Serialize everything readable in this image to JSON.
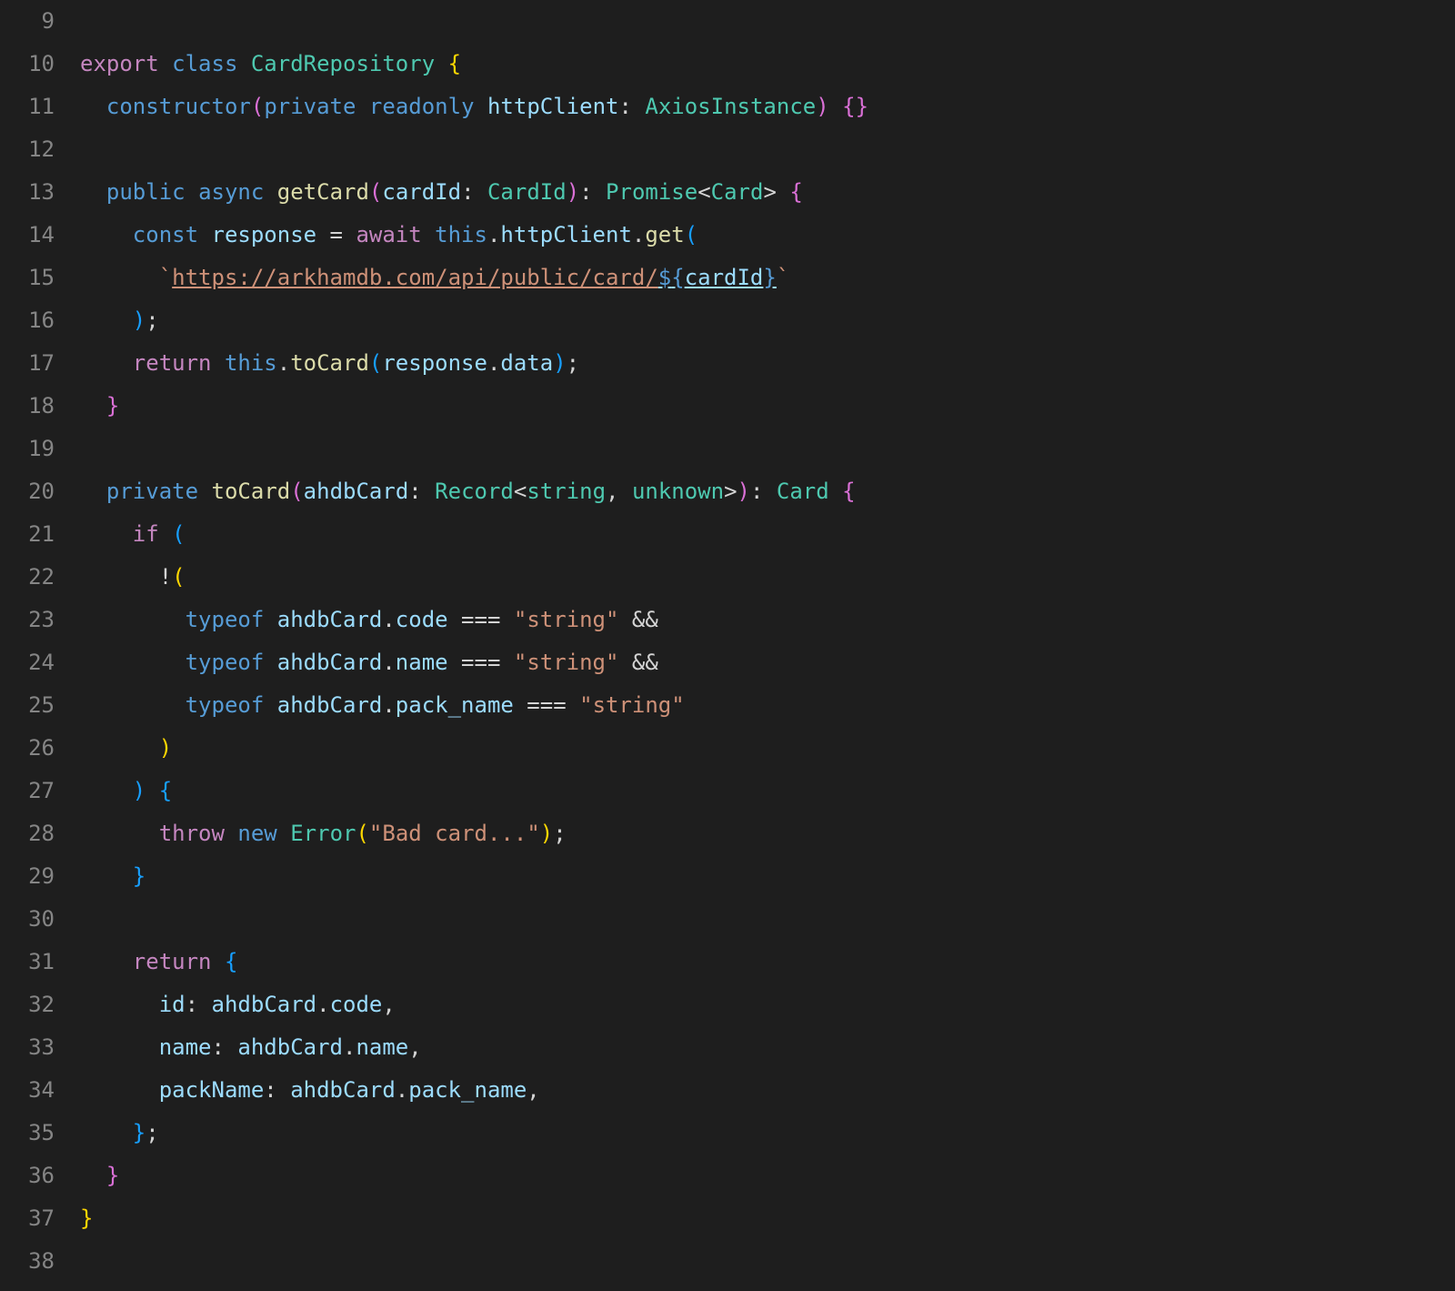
{
  "lines": {
    "9": {
      "no": "9"
    },
    "10": {
      "no": "10",
      "export": "export",
      "class_kw": "class",
      "class_name": "CardRepository",
      "lbrace": "{"
    },
    "11": {
      "no": "11",
      "constructor": "constructor",
      "lp": "(",
      "private": "private",
      "readonly": "readonly",
      "param": "httpClient",
      "colon": ":",
      "type": "AxiosInstance",
      "rp": ")",
      "lb": "{",
      "rb": "}"
    },
    "12": {
      "no": "12"
    },
    "13": {
      "no": "13",
      "public": "public",
      "async": "async",
      "fn": "getCard",
      "lp": "(",
      "param": "cardId",
      "colon": ":",
      "ptype": "CardId",
      "rp": ")",
      "colon2": ":",
      "prom": "Promise",
      "lt": "<",
      "card": "Card",
      "gt": ">",
      "lb": "{"
    },
    "14": {
      "no": "14",
      "const": "const",
      "resp": "response",
      "eq": "=",
      "await": "await",
      "this": "this",
      "dot": ".",
      "httpClient": "httpClient",
      "dot2": ".",
      "get": "get",
      "lp": "("
    },
    "15": {
      "no": "15",
      "bt1": "`",
      "url": "https://arkhamdb.com/api/public/card/",
      "dol": "$",
      "lbr": "{",
      "cardId": "cardId",
      "rbr": "}",
      "bt2": "`"
    },
    "16": {
      "no": "16",
      "rp": ")",
      "semi": ";"
    },
    "17": {
      "no": "17",
      "return": "return",
      "this": "this",
      "dot": ".",
      "toCard": "toCard",
      "lp": "(",
      "resp": "response",
      "dot2": ".",
      "data": "data",
      "rp": ")",
      "semi": ";"
    },
    "18": {
      "no": "18",
      "rb": "}"
    },
    "19": {
      "no": "19"
    },
    "20": {
      "no": "20",
      "private": "private",
      "fn": "toCard",
      "lp": "(",
      "param": "ahdbCard",
      "colon": ":",
      "rec": "Record",
      "lt": "<",
      "str": "string",
      "comma": ",",
      "unk": "unknown",
      "gt": ">",
      "rp": ")",
      "colon2": ":",
      "card": "Card",
      "lb": "{"
    },
    "21": {
      "no": "21",
      "if": "if",
      "lp": "("
    },
    "22": {
      "no": "22",
      "bang": "!",
      "lp": "("
    },
    "23": {
      "no": "23",
      "typeof": "typeof",
      "obj": "ahdbCard",
      "dot": ".",
      "prop": "code",
      "eqeq": "===",
      "q1": "\"",
      "s": "string",
      "q2": "\"",
      "and": "&&"
    },
    "24": {
      "no": "24",
      "typeof": "typeof",
      "obj": "ahdbCard",
      "dot": ".",
      "prop": "name",
      "eqeq": "===",
      "q1": "\"",
      "s": "string",
      "q2": "\"",
      "and": "&&"
    },
    "25": {
      "no": "25",
      "typeof": "typeof",
      "obj": "ahdbCard",
      "dot": ".",
      "prop": "pack_name",
      "eqeq": "===",
      "q1": "\"",
      "s": "string",
      "q2": "\""
    },
    "26": {
      "no": "26",
      "rp": ")"
    },
    "27": {
      "no": "27",
      "rp": ")",
      "lb": "{"
    },
    "28": {
      "no": "28",
      "throw": "throw",
      "new": "new",
      "err": "Error",
      "lp": "(",
      "q1": "\"",
      "msg": "Bad card...",
      "q2": "\"",
      "rp": ")",
      "semi": ";"
    },
    "29": {
      "no": "29",
      "rb": "}"
    },
    "30": {
      "no": "30"
    },
    "31": {
      "no": "31",
      "return": "return",
      "lb": "{"
    },
    "32": {
      "no": "32",
      "key": "id",
      "colon": ":",
      "obj": "ahdbCard",
      "dot": ".",
      "prop": "code",
      "comma": ","
    },
    "33": {
      "no": "33",
      "key": "name",
      "colon": ":",
      "obj": "ahdbCard",
      "dot": ".",
      "prop": "name",
      "comma": ","
    },
    "34": {
      "no": "34",
      "key": "packName",
      "colon": ":",
      "obj": "ahdbCard",
      "dot": ".",
      "prop": "pack_name",
      "comma": ","
    },
    "35": {
      "no": "35",
      "rb": "}",
      "semi": ";"
    },
    "36": {
      "no": "36",
      "rb": "}"
    },
    "37": {
      "no": "37",
      "rb": "}"
    },
    "38": {
      "no": "38"
    }
  }
}
